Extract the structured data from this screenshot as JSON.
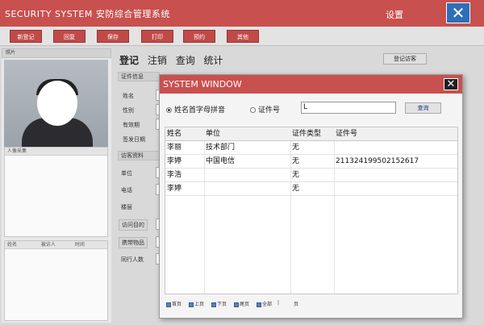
{
  "titlebar": {
    "app_title": "SECURITY  SYSTEM 安防综合管理系统",
    "settings": "设置",
    "close": "✕"
  },
  "toolbar": {
    "buttons": [
      "新登记",
      "回复",
      "保存",
      "打印",
      "预约",
      "其他"
    ]
  },
  "left_panel": {
    "photo_header": "照片",
    "card_box_label": "人像采集",
    "list_columns": [
      "姓名",
      "被访人",
      "时间"
    ]
  },
  "form": {
    "tabs": [
      "登记",
      "注销",
      "查询",
      "统计"
    ],
    "visit_button": "登记访客",
    "section_cert": "证件信息",
    "labels": {
      "name": "姓名",
      "sex": "性别",
      "valid": "有效期",
      "issue_date": "签发日期"
    },
    "section_visitor": "访客资料",
    "labels2": {
      "unit": "单位",
      "phone": "电话",
      "floor": "楼层",
      "purpose": "访问目的",
      "items": "携带物品",
      "companions": "同行人数"
    }
  },
  "dialog": {
    "title": "SYSTEM WINDOW",
    "close": "✕",
    "option_name": "姓名首字母拼音",
    "option_id": "证件号",
    "search_value": "L",
    "query_button": "查询",
    "columns": [
      "姓名",
      "单位",
      "证件类型",
      "证件号"
    ],
    "rows": [
      [
        "李丽",
        "技术部门",
        "无",
        ""
      ],
      [
        "李婷",
        "中国电信",
        "无",
        "211324199502152617"
      ],
      [
        "李浩",
        "",
        "无",
        ""
      ],
      [
        "李婷",
        "",
        "无",
        ""
      ]
    ],
    "pager": {
      "first": "首页",
      "prev": "上页",
      "next": "下页",
      "last": "尾页",
      "all": "全部",
      "page": "页",
      "sep": "|"
    }
  }
}
